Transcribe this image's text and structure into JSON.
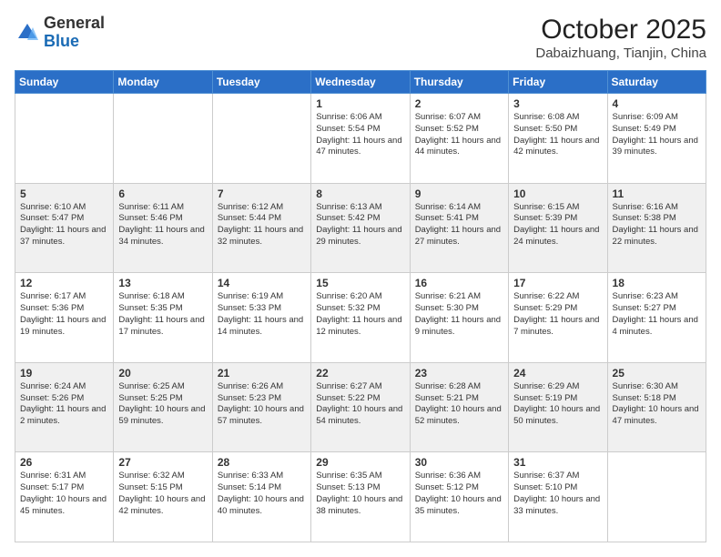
{
  "header": {
    "logo_general": "General",
    "logo_blue": "Blue",
    "month_title": "October 2025",
    "location": "Dabaizhuang, Tianjin, China"
  },
  "weekdays": [
    "Sunday",
    "Monday",
    "Tuesday",
    "Wednesday",
    "Thursday",
    "Friday",
    "Saturday"
  ],
  "weeks": [
    [
      {
        "day": "",
        "sunrise": "",
        "sunset": "",
        "daylight": ""
      },
      {
        "day": "",
        "sunrise": "",
        "sunset": "",
        "daylight": ""
      },
      {
        "day": "",
        "sunrise": "",
        "sunset": "",
        "daylight": ""
      },
      {
        "day": "1",
        "sunrise": "Sunrise: 6:06 AM",
        "sunset": "Sunset: 5:54 PM",
        "daylight": "Daylight: 11 hours and 47 minutes."
      },
      {
        "day": "2",
        "sunrise": "Sunrise: 6:07 AM",
        "sunset": "Sunset: 5:52 PM",
        "daylight": "Daylight: 11 hours and 44 minutes."
      },
      {
        "day": "3",
        "sunrise": "Sunrise: 6:08 AM",
        "sunset": "Sunset: 5:50 PM",
        "daylight": "Daylight: 11 hours and 42 minutes."
      },
      {
        "day": "4",
        "sunrise": "Sunrise: 6:09 AM",
        "sunset": "Sunset: 5:49 PM",
        "daylight": "Daylight: 11 hours and 39 minutes."
      }
    ],
    [
      {
        "day": "5",
        "sunrise": "Sunrise: 6:10 AM",
        "sunset": "Sunset: 5:47 PM",
        "daylight": "Daylight: 11 hours and 37 minutes."
      },
      {
        "day": "6",
        "sunrise": "Sunrise: 6:11 AM",
        "sunset": "Sunset: 5:46 PM",
        "daylight": "Daylight: 11 hours and 34 minutes."
      },
      {
        "day": "7",
        "sunrise": "Sunrise: 6:12 AM",
        "sunset": "Sunset: 5:44 PM",
        "daylight": "Daylight: 11 hours and 32 minutes."
      },
      {
        "day": "8",
        "sunrise": "Sunrise: 6:13 AM",
        "sunset": "Sunset: 5:42 PM",
        "daylight": "Daylight: 11 hours and 29 minutes."
      },
      {
        "day": "9",
        "sunrise": "Sunrise: 6:14 AM",
        "sunset": "Sunset: 5:41 PM",
        "daylight": "Daylight: 11 hours and 27 minutes."
      },
      {
        "day": "10",
        "sunrise": "Sunrise: 6:15 AM",
        "sunset": "Sunset: 5:39 PM",
        "daylight": "Daylight: 11 hours and 24 minutes."
      },
      {
        "day": "11",
        "sunrise": "Sunrise: 6:16 AM",
        "sunset": "Sunset: 5:38 PM",
        "daylight": "Daylight: 11 hours and 22 minutes."
      }
    ],
    [
      {
        "day": "12",
        "sunrise": "Sunrise: 6:17 AM",
        "sunset": "Sunset: 5:36 PM",
        "daylight": "Daylight: 11 hours and 19 minutes."
      },
      {
        "day": "13",
        "sunrise": "Sunrise: 6:18 AM",
        "sunset": "Sunset: 5:35 PM",
        "daylight": "Daylight: 11 hours and 17 minutes."
      },
      {
        "day": "14",
        "sunrise": "Sunrise: 6:19 AM",
        "sunset": "Sunset: 5:33 PM",
        "daylight": "Daylight: 11 hours and 14 minutes."
      },
      {
        "day": "15",
        "sunrise": "Sunrise: 6:20 AM",
        "sunset": "Sunset: 5:32 PM",
        "daylight": "Daylight: 11 hours and 12 minutes."
      },
      {
        "day": "16",
        "sunrise": "Sunrise: 6:21 AM",
        "sunset": "Sunset: 5:30 PM",
        "daylight": "Daylight: 11 hours and 9 minutes."
      },
      {
        "day": "17",
        "sunrise": "Sunrise: 6:22 AM",
        "sunset": "Sunset: 5:29 PM",
        "daylight": "Daylight: 11 hours and 7 minutes."
      },
      {
        "day": "18",
        "sunrise": "Sunrise: 6:23 AM",
        "sunset": "Sunset: 5:27 PM",
        "daylight": "Daylight: 11 hours and 4 minutes."
      }
    ],
    [
      {
        "day": "19",
        "sunrise": "Sunrise: 6:24 AM",
        "sunset": "Sunset: 5:26 PM",
        "daylight": "Daylight: 11 hours and 2 minutes."
      },
      {
        "day": "20",
        "sunrise": "Sunrise: 6:25 AM",
        "sunset": "Sunset: 5:25 PM",
        "daylight": "Daylight: 10 hours and 59 minutes."
      },
      {
        "day": "21",
        "sunrise": "Sunrise: 6:26 AM",
        "sunset": "Sunset: 5:23 PM",
        "daylight": "Daylight: 10 hours and 57 minutes."
      },
      {
        "day": "22",
        "sunrise": "Sunrise: 6:27 AM",
        "sunset": "Sunset: 5:22 PM",
        "daylight": "Daylight: 10 hours and 54 minutes."
      },
      {
        "day": "23",
        "sunrise": "Sunrise: 6:28 AM",
        "sunset": "Sunset: 5:21 PM",
        "daylight": "Daylight: 10 hours and 52 minutes."
      },
      {
        "day": "24",
        "sunrise": "Sunrise: 6:29 AM",
        "sunset": "Sunset: 5:19 PM",
        "daylight": "Daylight: 10 hours and 50 minutes."
      },
      {
        "day": "25",
        "sunrise": "Sunrise: 6:30 AM",
        "sunset": "Sunset: 5:18 PM",
        "daylight": "Daylight: 10 hours and 47 minutes."
      }
    ],
    [
      {
        "day": "26",
        "sunrise": "Sunrise: 6:31 AM",
        "sunset": "Sunset: 5:17 PM",
        "daylight": "Daylight: 10 hours and 45 minutes."
      },
      {
        "day": "27",
        "sunrise": "Sunrise: 6:32 AM",
        "sunset": "Sunset: 5:15 PM",
        "daylight": "Daylight: 10 hours and 42 minutes."
      },
      {
        "day": "28",
        "sunrise": "Sunrise: 6:33 AM",
        "sunset": "Sunset: 5:14 PM",
        "daylight": "Daylight: 10 hours and 40 minutes."
      },
      {
        "day": "29",
        "sunrise": "Sunrise: 6:35 AM",
        "sunset": "Sunset: 5:13 PM",
        "daylight": "Daylight: 10 hours and 38 minutes."
      },
      {
        "day": "30",
        "sunrise": "Sunrise: 6:36 AM",
        "sunset": "Sunset: 5:12 PM",
        "daylight": "Daylight: 10 hours and 35 minutes."
      },
      {
        "day": "31",
        "sunrise": "Sunrise: 6:37 AM",
        "sunset": "Sunset: 5:10 PM",
        "daylight": "Daylight: 10 hours and 33 minutes."
      },
      {
        "day": "",
        "sunrise": "",
        "sunset": "",
        "daylight": ""
      }
    ]
  ]
}
